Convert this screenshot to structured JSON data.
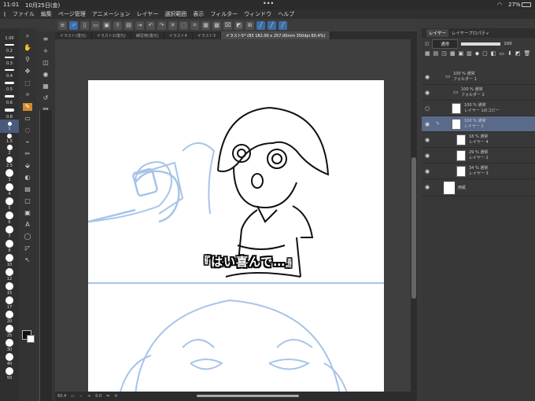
{
  "status": {
    "time": "11:01",
    "date": "10月25日(金)",
    "battery": "27%"
  },
  "menu": [
    "ファイル",
    "編集",
    "ページ管理",
    "アニメーション",
    "レイヤー",
    "選択範囲",
    "表示",
    "フィルター",
    "ウィンドウ",
    "ヘルプ"
  ],
  "tabs": [
    "イラスト(復元)",
    "イラスト2(復元)",
    "練習用(復元)",
    "イラスト4",
    "イラスト3",
    "イラスト5* (B5 182.00 x 257.00mm 350dpi 60.4%)"
  ],
  "canvas": {
    "caption": "『はい喜んで…』",
    "zoom": "60.4",
    "rotation": "0.0"
  },
  "brush_sizes": [
    "1.00",
    "0.2",
    "0.3",
    "0.4",
    "0.5",
    "0.6",
    "0.8",
    "1",
    "1.5",
    "2",
    "2.5",
    "3",
    "4",
    "5",
    "6",
    "7",
    "8",
    "10",
    "12",
    "15",
    "17",
    "20",
    "25",
    "30",
    "40",
    "50"
  ],
  "panel": {
    "tab_layer": "レイヤー",
    "tab_property": "レイヤープロパティ",
    "blend_mode": "通常",
    "opacity": "100"
  },
  "layers": [
    {
      "opacity": "100 %",
      "mode": "通常",
      "name": "フォルダー 1"
    },
    {
      "opacity": "100 %",
      "mode": "通常",
      "name": "フォルダー 2"
    },
    {
      "opacity": "100 %",
      "mode": "通常",
      "name": "レイヤー 1のコピー"
    },
    {
      "opacity": "100 %",
      "mode": "通常",
      "name": "レイヤー 2"
    },
    {
      "opacity": "18 %",
      "mode": "通常",
      "name": "レイヤー 4"
    },
    {
      "opacity": "29 %",
      "mode": "通常",
      "name": "レイヤー 1"
    },
    {
      "opacity": "34 %",
      "mode": "通常",
      "name": "レイヤー 3"
    },
    {
      "opacity": "",
      "mode": "",
      "name": "用紙"
    }
  ],
  "colors": {
    "accent": "#3a6ea8",
    "selected_layer": "#5a6a8a",
    "sketch_blue": "#a8c4e8"
  }
}
